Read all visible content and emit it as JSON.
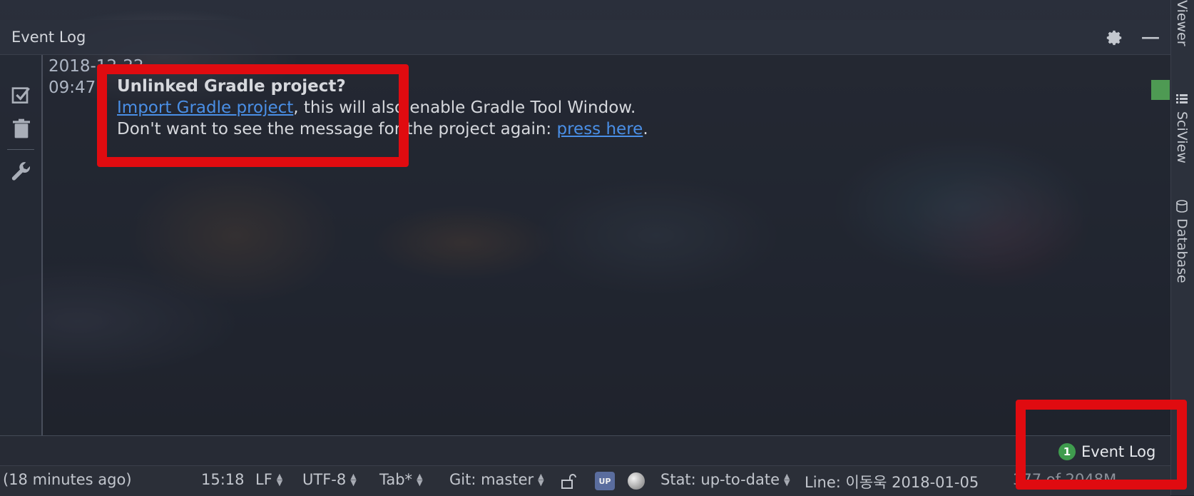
{
  "toolwindow": {
    "title": "Event Log"
  },
  "log": {
    "timestamp_date": "2018-12-22",
    "timestamp_time": "09:47",
    "message_title": "Unlinked Gradle project?",
    "import_link": "Import Gradle project",
    "line2_rest": ", this will also enable Gradle Tool Window.",
    "line3_prefix": "Don't want to see the message for the project again: ",
    "press_here_link": "press here",
    "line3_suffix": "."
  },
  "right_stripe": {
    "tabs": [
      "Viewer",
      "SciView",
      "Database"
    ]
  },
  "bottom_toolbar": {
    "event_log_label": "Event Log",
    "event_log_count": "1"
  },
  "status_bar": {
    "time_ago": "(18 minutes ago)",
    "position": "15:18",
    "line_separator": "LF",
    "encoding": "UTF-8",
    "indent": "Tab*",
    "git_branch": "Git: master",
    "upsource_badge": "UP",
    "stat": "Stat: up-to-date",
    "line_author": "Line: 이동욱 2018-01-05",
    "memory": "377 of 2048M"
  },
  "colors": {
    "highlight": "#e00b10",
    "link": "#4a8fe6",
    "badge": "#3f9c4e"
  },
  "icons": [
    "gear-icon",
    "minimize-icon",
    "checkbox-icon",
    "trash-icon",
    "wrench-icon",
    "lock-icon"
  ]
}
